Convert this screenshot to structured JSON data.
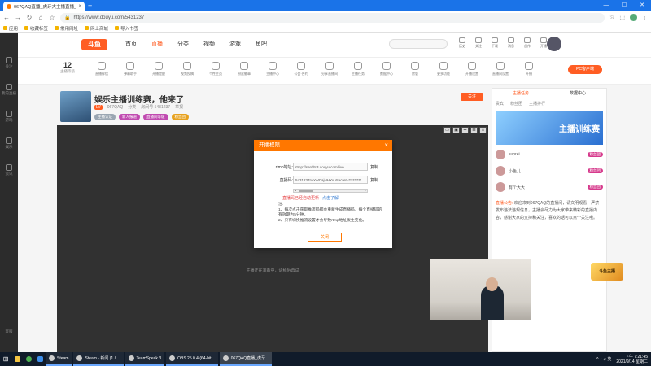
{
  "browser": {
    "tab_title": "067QAQ直播_虎牙大主播直播_斗...",
    "tab_close": "×",
    "new_tab": "+",
    "window_controls": [
      "—",
      "☐",
      "✕"
    ],
    "url": "https://www.douyu.com/5431237",
    "bookmarks": [
      "应用",
      "收藏标签",
      "常用网址",
      "网上商城",
      "导入书签"
    ]
  },
  "topnav": {
    "logo": "斗鱼",
    "links": [
      "首页",
      "直播",
      "分类",
      "视频",
      "游戏",
      "鱼吧"
    ],
    "active_index": 1,
    "icons": [
      "历史",
      "关注",
      "下载",
      "消息",
      "创作",
      "开播"
    ]
  },
  "leftbar": {
    "items": [
      "关注",
      "我的直播",
      "游戏",
      "娱乐",
      "资讯"
    ],
    "bottom": "客服"
  },
  "toolrow": {
    "stat_num": "12",
    "stat_label": "主播等级",
    "tools": [
      "直播伴侣",
      "弹幕助手",
      "开播提醒",
      "视频投稿",
      "个性主页",
      "粉丝徽章",
      "主播中心",
      "公会·合约",
      "分享直播间",
      "主播任务",
      "数据中心",
      "房管",
      "更多功能",
      "开播设置",
      "直播间设置",
      "开播"
    ],
    "pc_button": "PC客户端"
  },
  "room": {
    "title": "娱乐主播训练赛，他来了",
    "meta_tag": "LV",
    "meta": [
      "067QAQ",
      "分类",
      "房间号 5431237",
      "举报"
    ],
    "badges": [
      "主播认证",
      "新人报道",
      "直播间等级",
      "粉丝团"
    ],
    "right_button": "关注"
  },
  "player": {
    "controls": [
      "▭",
      "▣",
      "✚",
      "☰",
      "✕"
    ],
    "status": "主播正在准备中，请稍后再试"
  },
  "modal": {
    "title": "开播权限",
    "close": "×",
    "rtmp_label": "rtmp地址:",
    "rtmp_value": "rtmp://sendtc3.douyu.com/live",
    "key_label": "直播码:",
    "key_value": "5431237rwxWCajHHYuuSecret=*********",
    "copy_label": "复制",
    "warning": "直播码已经自动更新",
    "warning_link": "点击了解",
    "notes_heading": "注:",
    "notes": [
      "1、每次点击获取推流码都会重新生成直播码，每个直播码的有效期为5分钟。",
      "2、只有切换推流设置才会导致rtmp地址发生变化。"
    ],
    "close_button": "关闭"
  },
  "right_panel": {
    "header": [
      "主播任务",
      "数据中心"
    ],
    "tabs": [
      "贵宾",
      "粉丝团",
      "主播排行"
    ],
    "banner_text": "主播训练赛",
    "rows": [
      {
        "name": "suprei",
        "badge": "粉丝团"
      },
      {
        "name": "小鱼儿",
        "badge": "粉丝团"
      },
      {
        "name": "有个大大",
        "badge": "粉丝团"
      }
    ],
    "notice_label": "直播公告:",
    "notice": "欢迎来到067QAQ的直播间，请文明观看，严禁发布违法违规信息，主播会尽力为大家带来精彩的直播内容，感谢大家的支持和关注，喜欢的话可以点个关注哦。"
  },
  "cam_logo": "斗鱼主播",
  "taskbar": {
    "tasks": [
      "Steam",
      "Steam - 新闻 (1 / ...",
      "TeamSpeak 3",
      "OBS 25.0.4 (64-bit...",
      "067QAQ直播_虎牙..."
    ],
    "active_index": 4,
    "time": "下午 7:21:45",
    "date": "2021/9/14 星期二"
  },
  "colors": {
    "accent": "#ff5d23",
    "modal_header": "#ff7700",
    "warning": "#e4393c",
    "link": "#2f78d0",
    "chrome": "#1a73e8",
    "taskbar": "#101b2a"
  }
}
